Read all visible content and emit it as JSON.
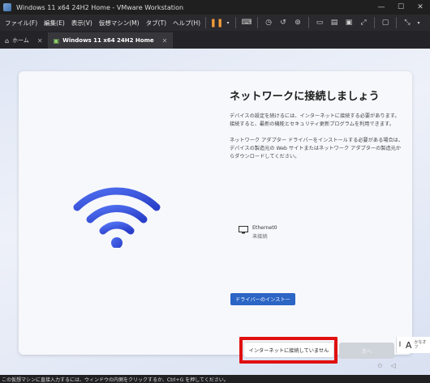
{
  "window": {
    "title": "Windows 11 x64 24H2 Home - VMware Workstation"
  },
  "menu": [
    "ファイル(F)",
    "編集(E)",
    "表示(V)",
    "仮想マシン(M)",
    "タブ(T)",
    "ヘルプ(H)"
  ],
  "toolbar_icons": [
    "pause-icon",
    "dropdown-icon",
    "send-ctrl-alt-del-icon",
    "snapshot-icon",
    "revert-snapshot-icon",
    "snapshot-manager-icon",
    "fullscreen-icon",
    "unity-icon",
    "console-view-icon",
    "autofit-icon",
    "stretch-icon",
    "terminal-icon",
    "view-options-icon"
  ],
  "tabs": [
    {
      "label": "ホーム",
      "icon": "home-icon"
    },
    {
      "label": "Windows 11 x64 24H2 Home",
      "icon": "vm-icon"
    }
  ],
  "oobe": {
    "heading": "ネットワークに接続しましょう",
    "body1": "デバイスの設定を続けるには、インターネットに接続する必要があります。接続すると、最新の機能とセキュリティ更新プログラムを利用できます。",
    "body2": "ネットワーク アダプター ドライバーをインストールする必要がある場合は、デバイスの製造元の Web サイトまたはネットワーク アダプターの製造元からダウンロードしてください。",
    "ethernet_name": "Ethernet0",
    "ethernet_status": "未接続",
    "driver_button": "ドライバーのインストー",
    "no_internet_button": "インターネットに接続していません",
    "next_button": "次へ",
    "accent_color": "#2b65c5",
    "highlight_color": "#e01010"
  },
  "ime": {
    "mode": "A",
    "label": "かなオフ"
  },
  "statusbar": {
    "text": "この仮想マシンに直接入力するには、ウィンドウの内側をクリックするか、Ctrl+G を押してください。"
  }
}
